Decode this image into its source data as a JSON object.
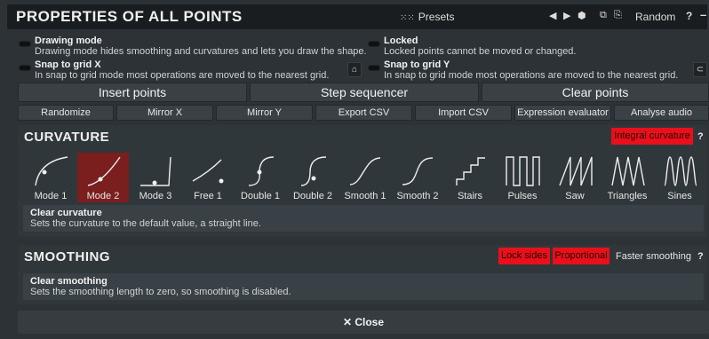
{
  "header": {
    "title": "PROPERTIES OF ALL POINTS",
    "presets": "Presets",
    "random": "Random",
    "help": "?",
    "minimize": "–"
  },
  "options": [
    {
      "title": "Drawing mode",
      "desc": "Drawing mode hides smoothing and curvatures and lets you draw the shape."
    },
    {
      "title": "Locked",
      "desc": "Locked points cannot be moved or changed."
    },
    {
      "title": "Snap to grid X",
      "desc": "In snap to grid mode most operations are moved to the nearest grid."
    },
    {
      "title": "Snap to grid Y",
      "desc": "In snap to grid mode most operations are moved to the nearest grid."
    }
  ],
  "big_buttons": [
    "Insert points",
    "Step sequencer",
    "Clear points"
  ],
  "small_buttons": [
    "Randomize",
    "Mirror X",
    "Mirror Y",
    "Export CSV",
    "Import CSV",
    "Expression evaluator",
    "Analyse audio"
  ],
  "curvature": {
    "title": "CURVATURE",
    "integral": "Integral curvature",
    "help": "?",
    "modes": [
      "Mode 1",
      "Mode 2",
      "Mode 3",
      "Free 1",
      "Double 1",
      "Double 2",
      "Smooth 1",
      "Smooth 2",
      "Stairs",
      "Pulses",
      "Saw",
      "Triangles",
      "Sines"
    ],
    "selected": "Mode 2",
    "info_title": "Clear curvature",
    "info_desc": "Sets the curvature to the default value, a straight line."
  },
  "smoothing": {
    "title": "SMOOTHING",
    "lock_sides": "Lock sides",
    "proportional": "Proportional",
    "faster": "Faster smoothing",
    "help": "?",
    "info_title": "Clear smoothing",
    "info_desc": "Sets the smoothing length to zero, so smoothing is disabled."
  },
  "close": "Close",
  "colors": {
    "accent_red": "#e8101a",
    "selected_tile": "#7a1e1e"
  }
}
